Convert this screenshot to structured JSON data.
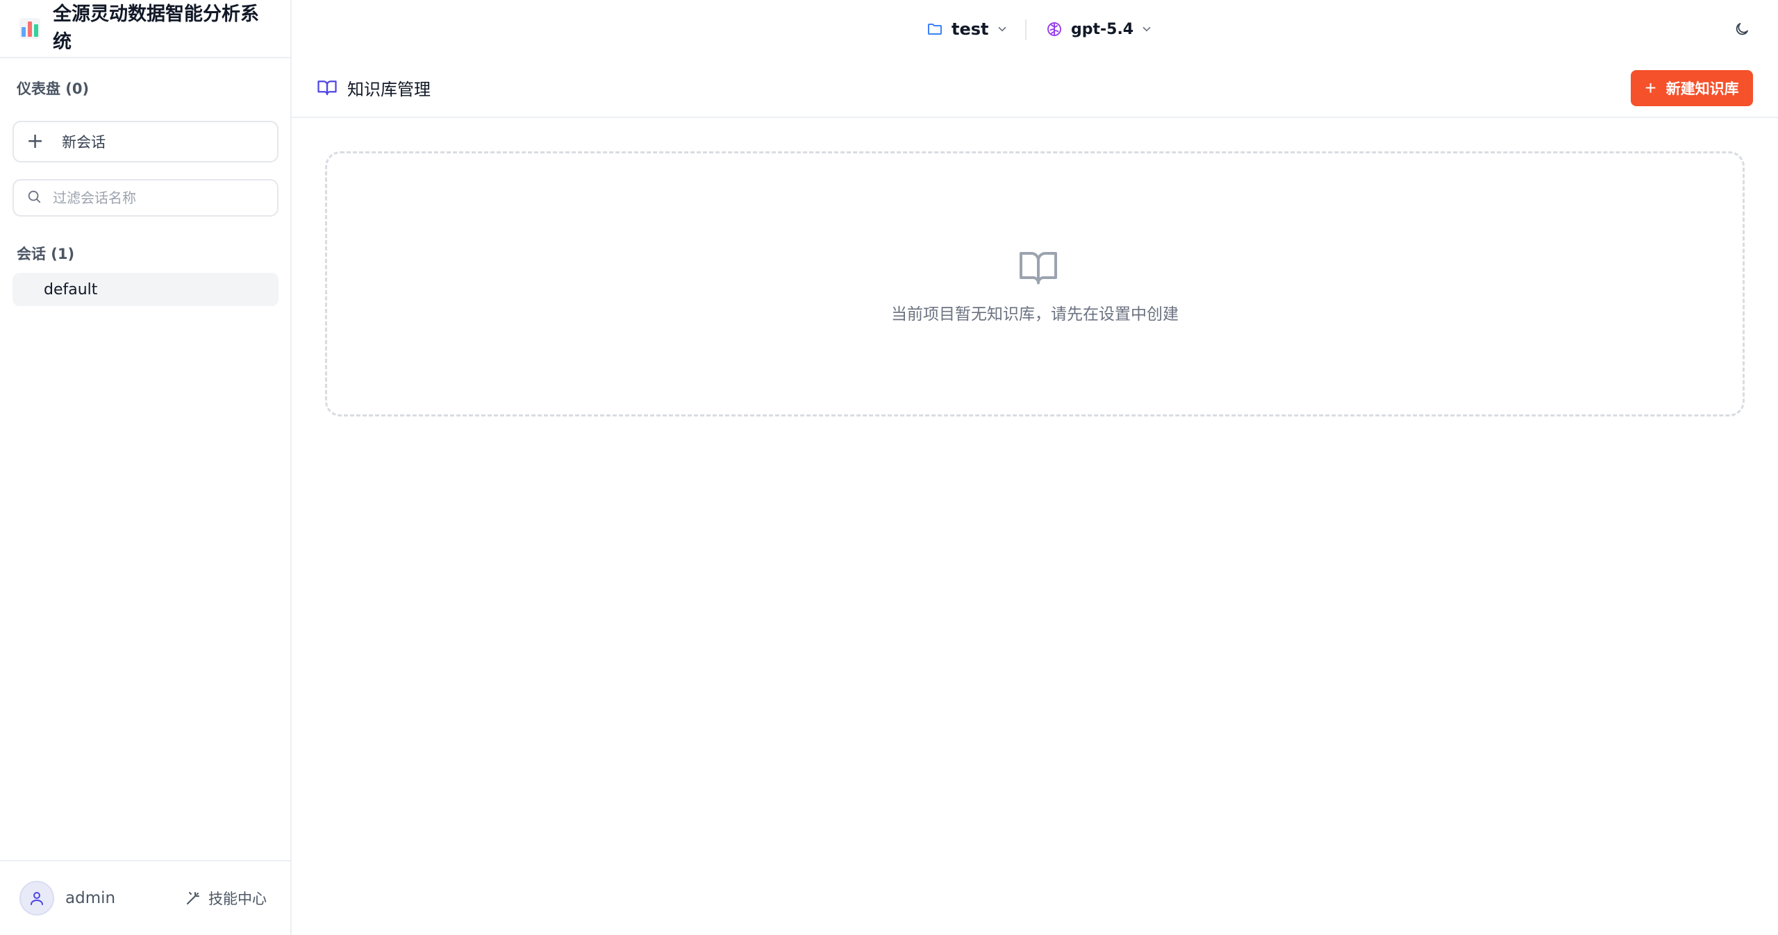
{
  "app": {
    "title": "全源灵动数据智能分析系统"
  },
  "sidebar": {
    "dashboard_label": "仪表盘 (0)",
    "new_chat_label": "新会话",
    "search": {
      "placeholder": "过滤会话名称",
      "value": ""
    },
    "sessions_label": "会话 (1)",
    "sessions": [
      {
        "name": "default",
        "active": true
      }
    ],
    "footer": {
      "username": "admin",
      "skills_label": "技能中心"
    }
  },
  "topbar": {
    "project": {
      "label": "test",
      "icon": "folder-icon"
    },
    "model": {
      "label": "gpt-5.4",
      "icon": "brain-icon"
    },
    "theme_icon": "moon-icon"
  },
  "page": {
    "title": "知识库管理",
    "title_icon": "book-icon",
    "create_button_label": "新建知识库",
    "empty_message": "当前项目暂无知识库，请先在设置中创建"
  },
  "colors": {
    "accent": "#f5512b",
    "project_icon": "#3b82f6",
    "model_icon": "#9333ea",
    "title_icon": "#4f46e5"
  }
}
